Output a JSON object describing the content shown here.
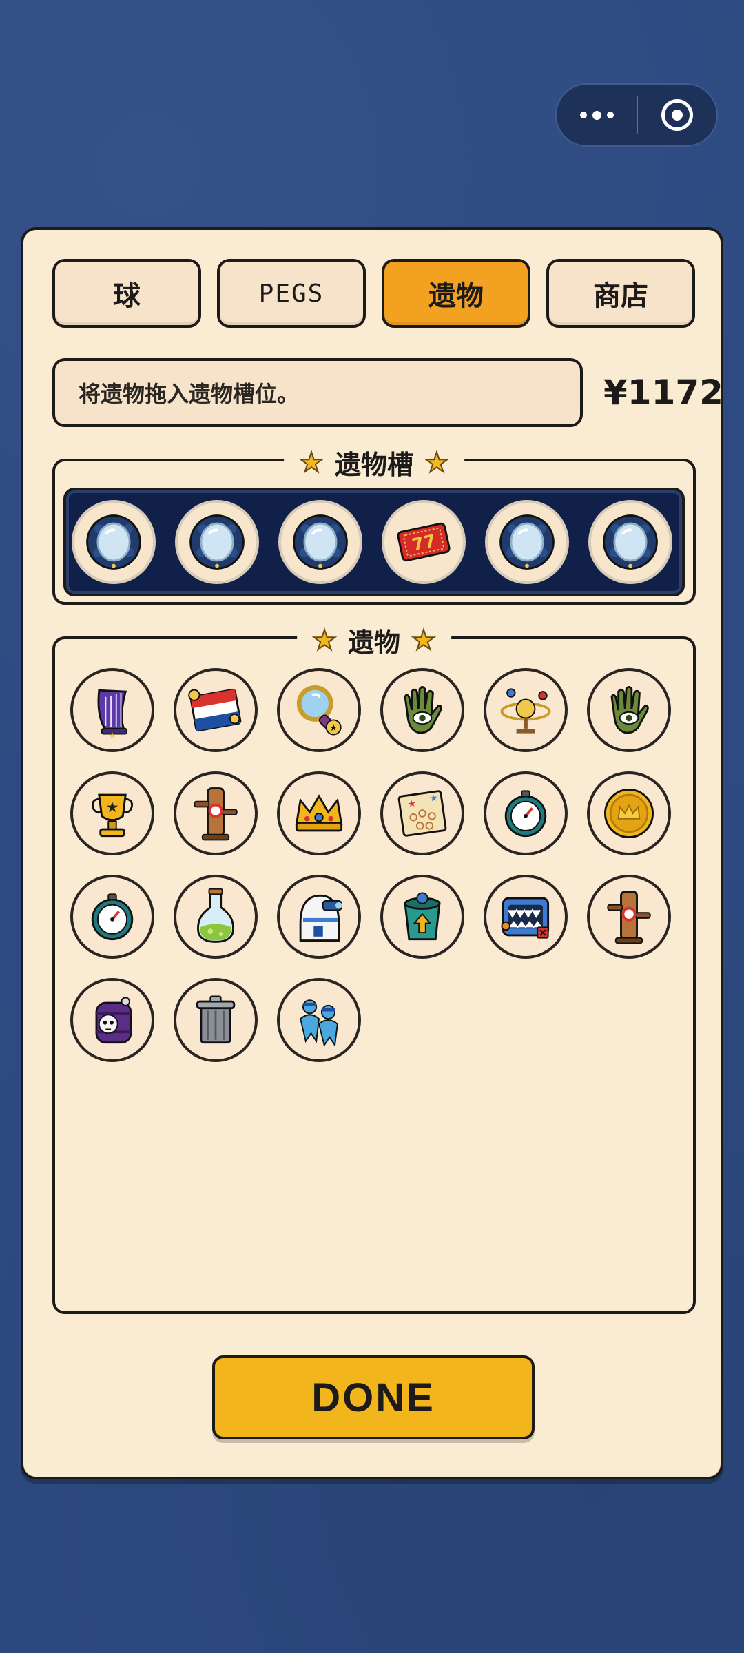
{
  "tabs": [
    {
      "label": "球"
    },
    {
      "label": "PEGS"
    },
    {
      "label": "遗物",
      "active": true
    },
    {
      "label": "商店"
    }
  ],
  "hint": "将遗物拖入遗物槽位。",
  "money": "¥1172",
  "equipped_section": {
    "title": "遗物槽",
    "slots": [
      "mirror-icon",
      "mirror-icon",
      "mirror-icon",
      "lucky-77-ticket-icon",
      "mirror-icon",
      "mirror-icon"
    ]
  },
  "inventory_section": {
    "title": "遗物",
    "items": [
      "harp-icon",
      "flag-sticker-icon",
      "magnifier-icon",
      "eye-hand-icon",
      "orrery-icon",
      "eye-hand-icon",
      "trophy-icon",
      "target-post-icon",
      "crown-icon",
      "treasure-map-icon",
      "stopwatch-icon",
      "gold-coin-icon",
      "stopwatch-icon",
      "potion-flask-icon",
      "robot-dome-icon",
      "bucket-arrow-icon",
      "mimic-monitor-icon",
      "target-post-icon",
      "skull-barrel-icon",
      "trash-can-icon",
      "twin-figures-icon"
    ]
  },
  "done_label": "DONE",
  "colors": {
    "background": "#2d4b82",
    "panel": "#faebd3",
    "active_tab": "#f3a120",
    "done_button": "#f2b51c",
    "slot_bar": "#112048"
  }
}
